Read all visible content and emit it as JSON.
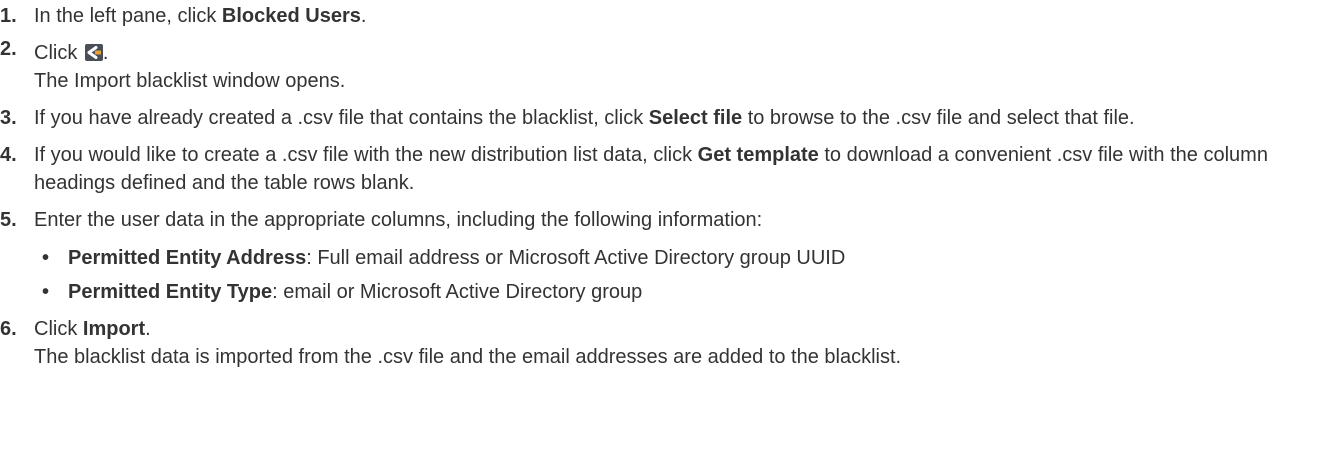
{
  "steps": [
    {
      "number": "1.",
      "before": "In the left pane, click ",
      "bold": "Blocked Users",
      "after": "."
    },
    {
      "number": "2.",
      "before": "Click ",
      "after": ".",
      "icon": "import-icon",
      "result": "The Import blacklist window opens."
    },
    {
      "number": "3.",
      "before": "If you have already created a .csv file that contains the blacklist, click ",
      "bold": "Select file",
      "after": " to browse to the .csv file and select that file."
    },
    {
      "number": "4.",
      "before": "If you would like to create a .csv file with the new distribution list data, click ",
      "bold": "Get template",
      "after": " to download a convenient .csv file with the column headings defined and the table rows blank."
    },
    {
      "number": "5.",
      "text": "Enter the user data in the appropriate columns, including the following information:",
      "bullets": [
        {
          "bullet": "•",
          "bold": "Permitted Entity Address",
          "text": ": Full email address or Microsoft Active Directory group UUID"
        },
        {
          "bullet": "•",
          "bold": "Permitted Entity Type",
          "text": ": email or Microsoft Active Directory group"
        }
      ]
    },
    {
      "number": "6.",
      "before": "Click ",
      "bold": "Import",
      "after": ".",
      "result": "The blacklist data is imported from the .csv file and the email addresses are added to the blacklist."
    }
  ],
  "colors": {
    "text": "#333333",
    "icon_bg": "#4a4f57",
    "icon_fg": "#ffffff",
    "icon_accent": "#e8a23a"
  }
}
